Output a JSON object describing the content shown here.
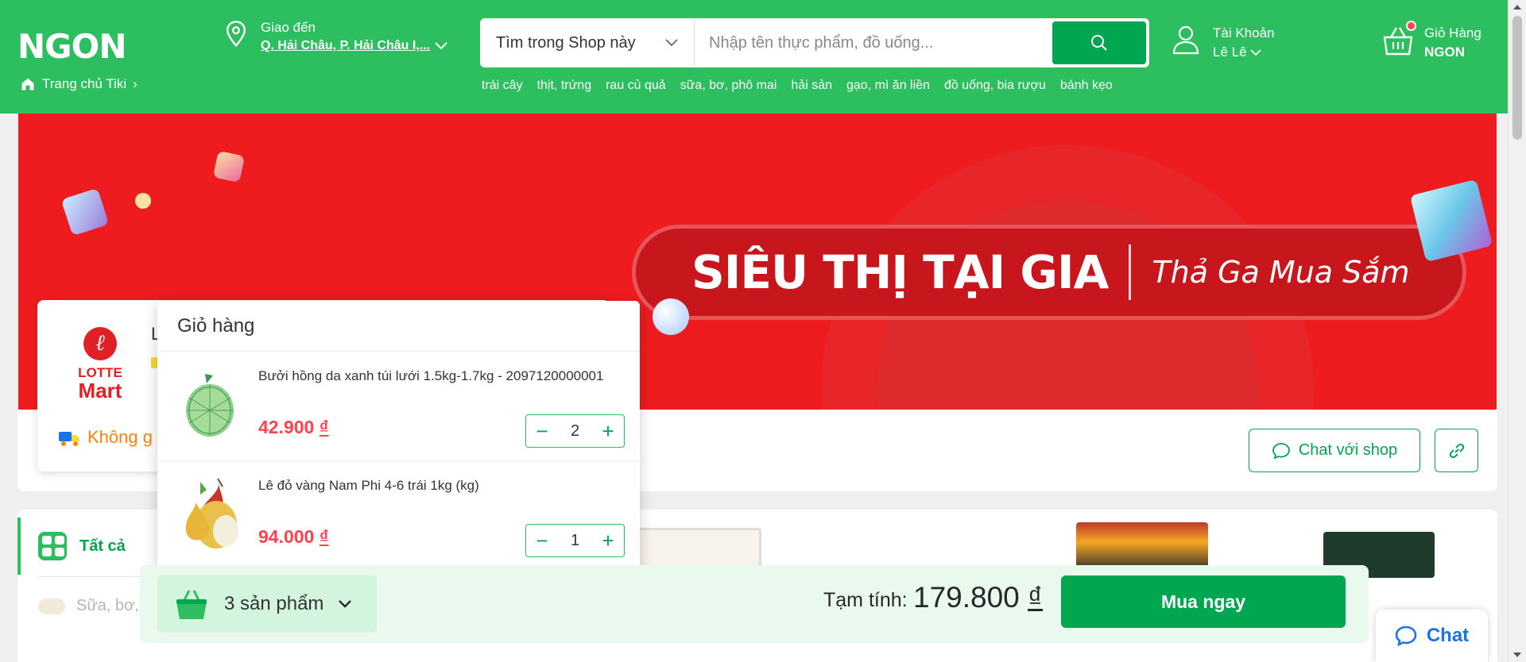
{
  "header": {
    "logo": "NGON",
    "home_link": "Trang chủ Tiki",
    "delivery_label": "Giao đến",
    "delivery_address": "Q. Hải Châu, P. Hải Châu I,...",
    "search_scope": "Tìm trong Shop này",
    "search_placeholder": "Nhập tên thực phẩm, đồ uống...",
    "quick_links": [
      "trái cây",
      "thịt, trứng",
      "rau củ quả",
      "sữa, bơ, phô mai",
      "hải sản",
      "gạo, mì ăn liền",
      "đồ uống, bia rượu",
      "bánh kẹo"
    ],
    "account_label": "Tài Khoản",
    "account_name": "Lê Lê",
    "cart_label": "Giỏ Hàng",
    "cart_store": "NGON"
  },
  "banner": {
    "headline": "SIÊU THỊ TẠI GIA",
    "slogan": "Thả Ga Mua Sắm"
  },
  "shop": {
    "logo_line1": "LOTTE",
    "logo_line2": "Mart",
    "name_fragment": "L",
    "shipping_fragment": "Không g",
    "chat_button": "Chat với shop"
  },
  "categories": {
    "all_label": "Tất cả",
    "item_fragment": "Sữa, bơ,"
  },
  "cart_popup": {
    "title": "Giỏ hàng",
    "items": [
      {
        "name": "Bưởi hồng da xanh túi lưới 1.5kg-1.7kg - 2097120000001",
        "price": "42.900 ",
        "currency": "₫",
        "quantity": "2"
      },
      {
        "name": "Lê đỏ vàng Nam Phi 4-6 trái 1kg (kg)",
        "price": "94.000 ",
        "currency": "₫",
        "quantity": "1"
      }
    ],
    "minus_symbol": "−",
    "plus_symbol": "+"
  },
  "cart_bar": {
    "count_label": "3 sản phẩm",
    "subtotal_label": "Tạm tính:",
    "subtotal_value": "179.800 ",
    "currency": "₫",
    "buy_button": "Mua ngay"
  },
  "chat_float": {
    "label": "Chat"
  },
  "colors": {
    "brand_green": "#2dbe60",
    "button_green": "#00a650",
    "price_red": "#ff424e",
    "banner_red": "#ee1c1f",
    "ship_orange": "#fd820a",
    "chat_blue": "#1a73e8"
  },
  "icons": [
    "home-icon",
    "location-pin-icon",
    "chevron-down-icon",
    "search-icon",
    "user-icon",
    "basket-icon",
    "truck-icon",
    "chat-bubble-icon",
    "link-icon",
    "grid-icon",
    "minus-icon",
    "plus-icon"
  ]
}
